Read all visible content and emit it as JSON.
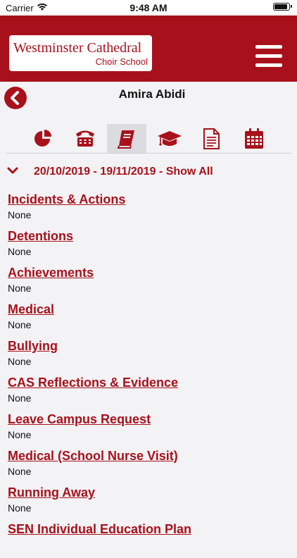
{
  "status_bar": {
    "carrier": "Carrier",
    "time": "9:48 AM",
    "battery_level": 0.95
  },
  "header": {
    "logo_line1": "Westminster Cathedral",
    "logo_line2": "Choir School",
    "menu_icon": "hamburger-menu-icon",
    "color": "#a8111b"
  },
  "page": {
    "title": "Amira Abidi",
    "back_icon": "chevron-left-circle-icon"
  },
  "tabs": [
    {
      "icon": "pie-chart-icon",
      "active": false
    },
    {
      "icon": "telephone-icon",
      "active": false
    },
    {
      "icon": "book-icon",
      "active": true
    },
    {
      "icon": "graduation-cap-icon",
      "active": false
    },
    {
      "icon": "document-icon",
      "active": false
    },
    {
      "icon": "calendar-icon",
      "active": false
    }
  ],
  "date_range": {
    "text": "20/10/2019 - 19/11/2019 - Show All",
    "icon": "chevron-down-icon"
  },
  "sections": [
    {
      "title": "Incidents & Actions",
      "value": "None"
    },
    {
      "title": "Detentions",
      "value": "None"
    },
    {
      "title": "Achievements",
      "value": "None"
    },
    {
      "title": "Medical",
      "value": "None"
    },
    {
      "title": "Bullying",
      "value": "None"
    },
    {
      "title": "CAS Reflections & Evidence",
      "value": "None"
    },
    {
      "title": "Leave Campus Request",
      "value": "None"
    },
    {
      "title": "Medical (School Nurse Visit)",
      "value": "None"
    },
    {
      "title": "Running Away",
      "value": "None"
    },
    {
      "title": "SEN Individual Education Plan",
      "value": ""
    }
  ]
}
